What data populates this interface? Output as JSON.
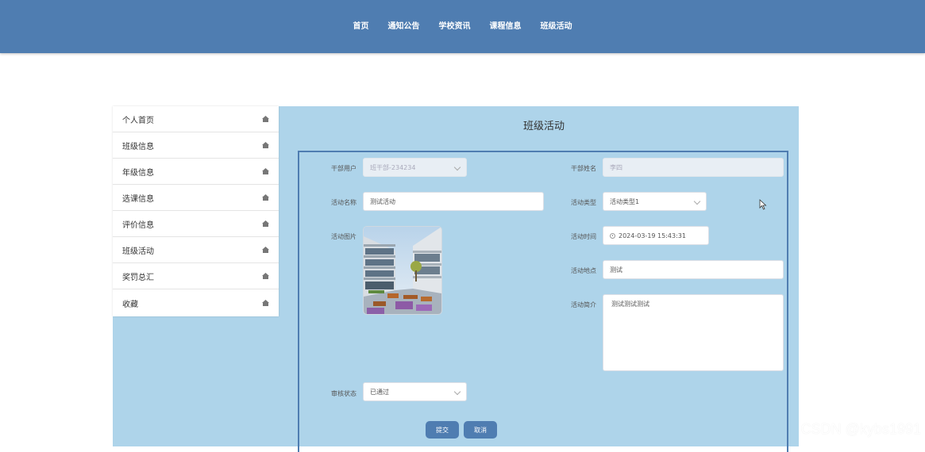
{
  "nav": {
    "items": [
      "首页",
      "通知公告",
      "学校资讯",
      "课程信息",
      "班级活动"
    ]
  },
  "sidebar": {
    "items": [
      {
        "label": "个人首页",
        "icon": "home-icon"
      },
      {
        "label": "班级信息",
        "icon": "home-icon"
      },
      {
        "label": "年级信息",
        "icon": "home-icon"
      },
      {
        "label": "选课信息",
        "icon": "home-icon"
      },
      {
        "label": "评价信息",
        "icon": "home-icon"
      },
      {
        "label": "班级活动",
        "icon": "home-icon"
      },
      {
        "label": "奖罚总汇",
        "icon": "home-icon"
      },
      {
        "label": "收藏",
        "icon": "home-icon"
      }
    ]
  },
  "page": {
    "title": "班级活动"
  },
  "form": {
    "cadre_user": {
      "label": "干部用户",
      "value": "班干部-234234"
    },
    "cadre_name": {
      "label": "干部姓名",
      "value": "李四"
    },
    "activity_name": {
      "label": "活动名称",
      "value": "测试活动"
    },
    "activity_type": {
      "label": "活动类型",
      "value": "活动类型1"
    },
    "activity_image": {
      "label": "活动图片"
    },
    "activity_time": {
      "label": "活动时间",
      "value": "2024-03-19 15:43:31"
    },
    "activity_place": {
      "label": "活动地点",
      "value": "测试"
    },
    "activity_intro": {
      "label": "活动简介",
      "value": "测试测试测试"
    },
    "review_status": {
      "label": "审核状态",
      "value": "已通过"
    },
    "submit_label": "提交",
    "cancel_label": "取消"
  },
  "watermark": "CSDN @kybs1991",
  "colors": {
    "nav_bg": "#4f7db1",
    "content_bg": "#aed4ea",
    "button_bg": "#4f7db1"
  }
}
